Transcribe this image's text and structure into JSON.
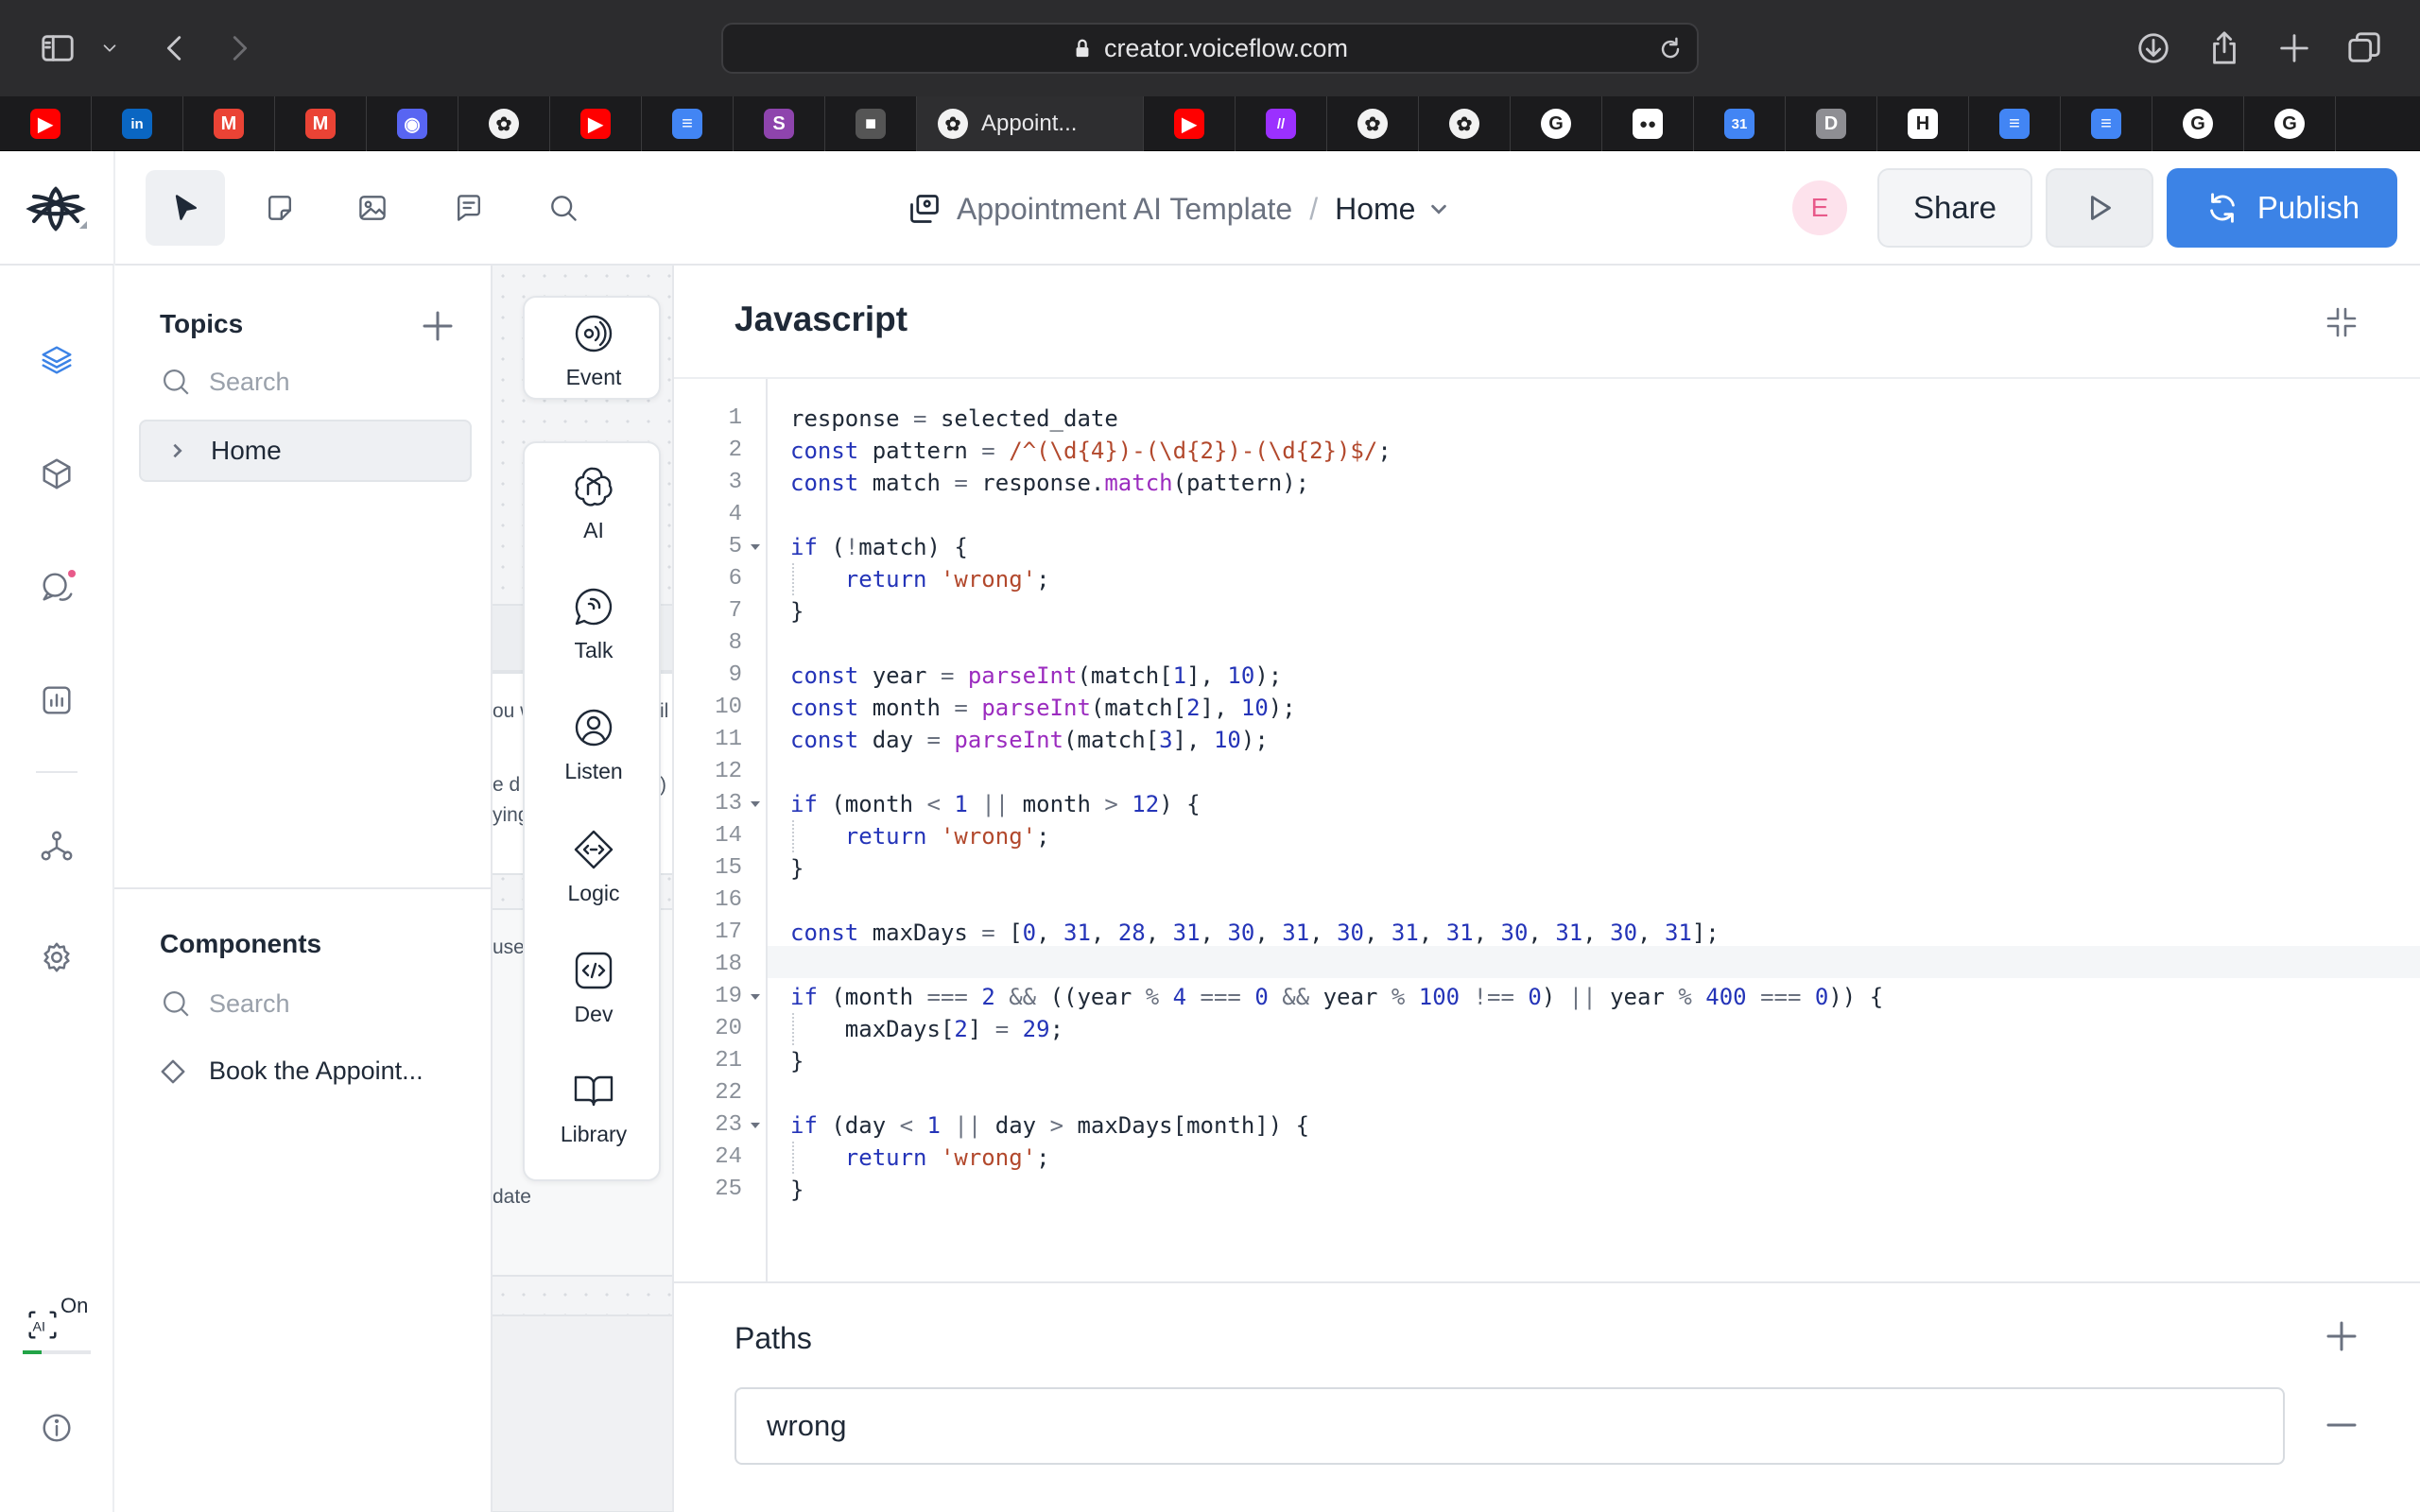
{
  "browser": {
    "url": "creator.voiceflow.com",
    "active_tab_title": "Appoint..."
  },
  "tabs": [
    {
      "icon": "youtube-icon",
      "color": "#ff0000",
      "glyph": "▶"
    },
    {
      "icon": "linkedin-icon",
      "color": "#0a66c2",
      "glyph": "in"
    },
    {
      "icon": "gmail-icon",
      "color": "#ea4335",
      "glyph": "M"
    },
    {
      "icon": "gmail-icon",
      "color": "#ea4335",
      "glyph": "M"
    },
    {
      "icon": "discord-icon",
      "color": "#5865f2",
      "glyph": "◉"
    },
    {
      "icon": "voiceflow-icon",
      "color": "#f2f2f2",
      "glyph": "✿"
    },
    {
      "icon": "youtube-icon",
      "color": "#ff0000",
      "glyph": "▶"
    },
    {
      "icon": "docs-icon",
      "color": "#4285f4",
      "glyph": "≡"
    },
    {
      "icon": "s-icon",
      "color": "#8e44ad",
      "glyph": "S"
    },
    {
      "icon": "cube-icon",
      "color": "#555555",
      "glyph": "■"
    },
    {
      "icon": "voiceflow-icon",
      "color": "#f2f2f2",
      "glyph": "✿"
    },
    {
      "icon": "youtube-icon",
      "color": "#ff0000",
      "glyph": "▶"
    },
    {
      "icon": "make-icon",
      "color": "#9b30ff",
      "glyph": "//"
    },
    {
      "icon": "voiceflow-icon",
      "color": "#f2f2f2",
      "glyph": "✿"
    },
    {
      "icon": "voiceflow-icon",
      "color": "#f2f2f2",
      "glyph": "✿"
    },
    {
      "icon": "google-icon",
      "color": "#ffffff",
      "glyph": "G"
    },
    {
      "icon": "medium-icon",
      "color": "#ffffff",
      "glyph": "●●"
    },
    {
      "icon": "calendar-icon",
      "color": "#4285f4",
      "glyph": "31"
    },
    {
      "icon": "d-icon",
      "color": "#8e8e93",
      "glyph": "D"
    },
    {
      "icon": "h-icon",
      "color": "#ffffff",
      "glyph": "H"
    },
    {
      "icon": "docs-icon",
      "color": "#4285f4",
      "glyph": "≡"
    },
    {
      "icon": "docs-icon",
      "color": "#4285f4",
      "glyph": "≡"
    },
    {
      "icon": "google-icon",
      "color": "#ffffff",
      "glyph": "G"
    },
    {
      "icon": "google-icon",
      "color": "#ffffff",
      "glyph": "G"
    }
  ],
  "header": {
    "project_name": "Appointment AI Template",
    "separator": "/",
    "current_page": "Home",
    "avatar_initial": "E",
    "share_label": "Share",
    "publish_label": "Publish",
    "accent_color": "#3c83e6"
  },
  "topics": {
    "title": "Topics",
    "search_placeholder": "Search",
    "items": [
      {
        "label": "Home"
      }
    ]
  },
  "components": {
    "title": "Components",
    "search_placeholder": "Search",
    "items": [
      {
        "label": "Book the Appoint..."
      }
    ]
  },
  "canvas_fragments": [
    "ou w",
    "il",
    "e d",
    "ying",
    ")",
    "use",
    "date"
  ],
  "palette": [
    {
      "label": "Event",
      "icon": "event-icon"
    },
    {
      "label": "AI",
      "icon": "ai-icon"
    },
    {
      "label": "Talk",
      "icon": "talk-icon"
    },
    {
      "label": "Listen",
      "icon": "listen-icon"
    },
    {
      "label": "Logic",
      "icon": "logic-icon"
    },
    {
      "label": "Dev",
      "icon": "dev-icon"
    },
    {
      "label": "Library",
      "icon": "library-icon"
    }
  ],
  "ai_toggle": {
    "label": "On"
  },
  "editor": {
    "title": "Javascript",
    "lines": [
      "response = selected_date",
      "const pattern = /^(\\d{4})-(\\d{2})-(\\d{2})$/;",
      "const match = response.match(pattern);",
      "",
      "if (!match) {",
      "    return 'wrong';",
      "}",
      "",
      "const year = parseInt(match[1], 10);",
      "const month = parseInt(match[2], 10);",
      "const day = parseInt(match[3], 10);",
      "",
      "if (month < 1 || month > 12) {",
      "    return 'wrong';",
      "}",
      "",
      "const maxDays = [0, 31, 28, 31, 30, 31, 30, 31, 31, 30, 31, 30, 31];",
      "",
      "if (month === 2 && ((year % 4 === 0 && year % 100 !== 0) || year % 400 === 0)) {",
      "    maxDays[2] = 29;",
      "}",
      "",
      "if (day < 1 || day > maxDays[month]) {",
      "    return 'wrong';",
      "}"
    ]
  },
  "paths": {
    "title": "Paths",
    "items": [
      {
        "value": "wrong"
      }
    ]
  }
}
